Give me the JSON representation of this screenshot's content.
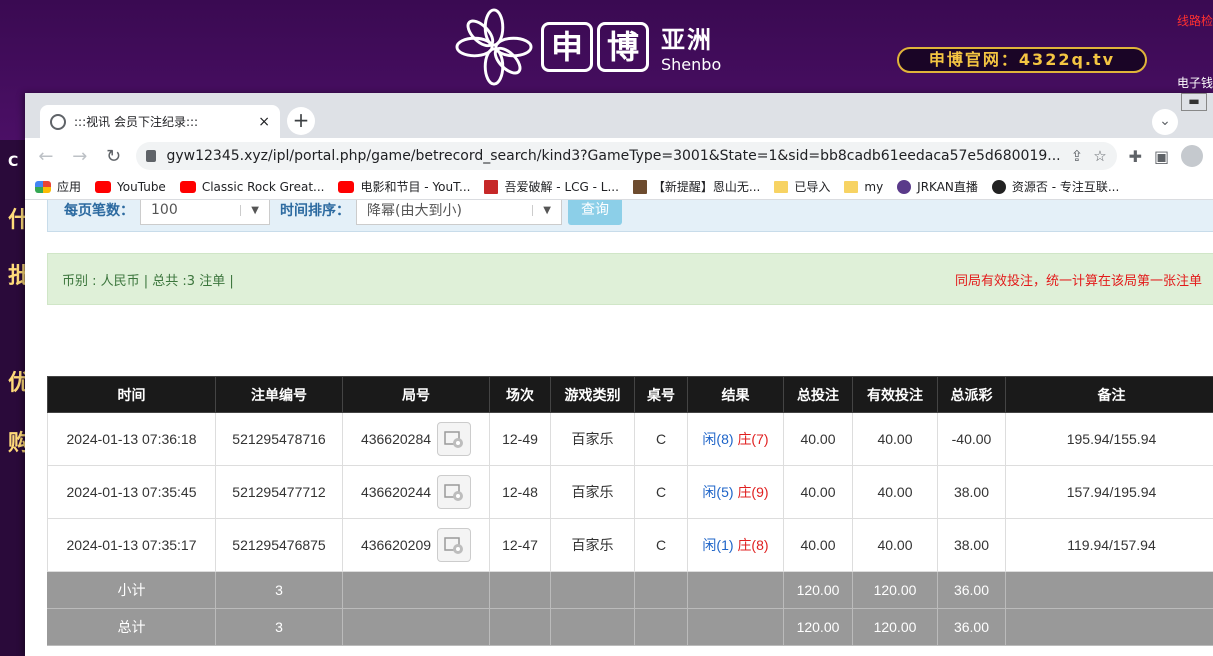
{
  "background": {
    "brand_cn_1": "申",
    "brand_cn_2": "博",
    "brand_side_cn": "亚洲",
    "brand_side_en": "Shenbo",
    "official_site": "申博官网：4322q.tv",
    "line_check": "线路检",
    "ewallet": "电子钱",
    "left_chars": [
      "什",
      "批",
      "优",
      "购"
    ],
    "left_letter": "C"
  },
  "browser": {
    "tab_title": ":::视讯 会员下注纪录:::",
    "tab_close": "×",
    "new_tab": "+",
    "url": "gyw12345.xyz/ipl/portal.php/game/betrecord_search/kind3?GameType=3001&State=1&sid=bb8cadb61eedaca57e5d680019...",
    "bookmarks": [
      {
        "icon": "apps-grid-icon",
        "label": "应用"
      },
      {
        "icon": "youtube-icon",
        "label": "YouTube"
      },
      {
        "icon": "youtube-icon",
        "label": "Classic Rock Great..."
      },
      {
        "icon": "youtube-icon",
        "label": "电影和节目 - YouT..."
      },
      {
        "icon": "lcg-icon",
        "label": "吾爱破解 - LCG - L..."
      },
      {
        "icon": "image-icon",
        "label": "【新提醒】恩山无..."
      },
      {
        "icon": "folder-icon",
        "label": "已导入"
      },
      {
        "icon": "folder-icon",
        "label": "my"
      },
      {
        "icon": "jrkan-icon",
        "label": "JRKAN直播"
      },
      {
        "icon": "github-icon",
        "label": "资源否 - 专注互联..."
      }
    ]
  },
  "filter": {
    "per_page_label": "每页笔数：",
    "per_page_value": "100",
    "sort_label": "时间排序：",
    "sort_value": "降幂(由大到小)",
    "query_button": "查询"
  },
  "summary": {
    "left": "币别 : 人民币 | 总共 :3 注单 |",
    "right": "同局有效投注，统一计算在该局第一张注单"
  },
  "table": {
    "headers": [
      "时间",
      "注单编号",
      "局号",
      "场次",
      "游戏类别",
      "桌号",
      "结果",
      "总投注",
      "有效投注",
      "总派彩",
      "备注"
    ],
    "rows": [
      {
        "time": "2024-01-13 07:36:18",
        "bet_id": "521295478716",
        "round_id": "436620284",
        "shoe": "12-49",
        "game": "百家乐",
        "table": "C",
        "player": "闲(8)",
        "banker": "庄(7)",
        "total_bet": "40.00",
        "valid_bet": "40.00",
        "payout": "-40.00",
        "note": "195.94/155.94"
      },
      {
        "time": "2024-01-13 07:35:45",
        "bet_id": "521295477712",
        "round_id": "436620244",
        "shoe": "12-48",
        "game": "百家乐",
        "table": "C",
        "player": "闲(5)",
        "banker": "庄(9)",
        "total_bet": "40.00",
        "valid_bet": "40.00",
        "payout": "38.00",
        "note": "157.94/195.94"
      },
      {
        "time": "2024-01-13 07:35:17",
        "bet_id": "521295476875",
        "round_id": "436620209",
        "shoe": "12-47",
        "game": "百家乐",
        "table": "C",
        "player": "闲(1)",
        "banker": "庄(8)",
        "total_bet": "40.00",
        "valid_bet": "40.00",
        "payout": "38.00",
        "note": "119.94/157.94"
      }
    ],
    "subtotal": {
      "label": "小计",
      "count": "3",
      "total_bet": "120.00",
      "valid_bet": "120.00",
      "payout": "36.00"
    },
    "grand_total": {
      "label": "总计",
      "count": "3",
      "total_bet": "120.00",
      "valid_bet": "120.00",
      "payout": "36.00"
    }
  },
  "colors": {
    "header_bg": "#1a1a1a",
    "summary_bg": "#dff0d8",
    "total_row_bg": "#999999",
    "bet_blue": "#1e64c8",
    "banker_red": "#e02020"
  }
}
